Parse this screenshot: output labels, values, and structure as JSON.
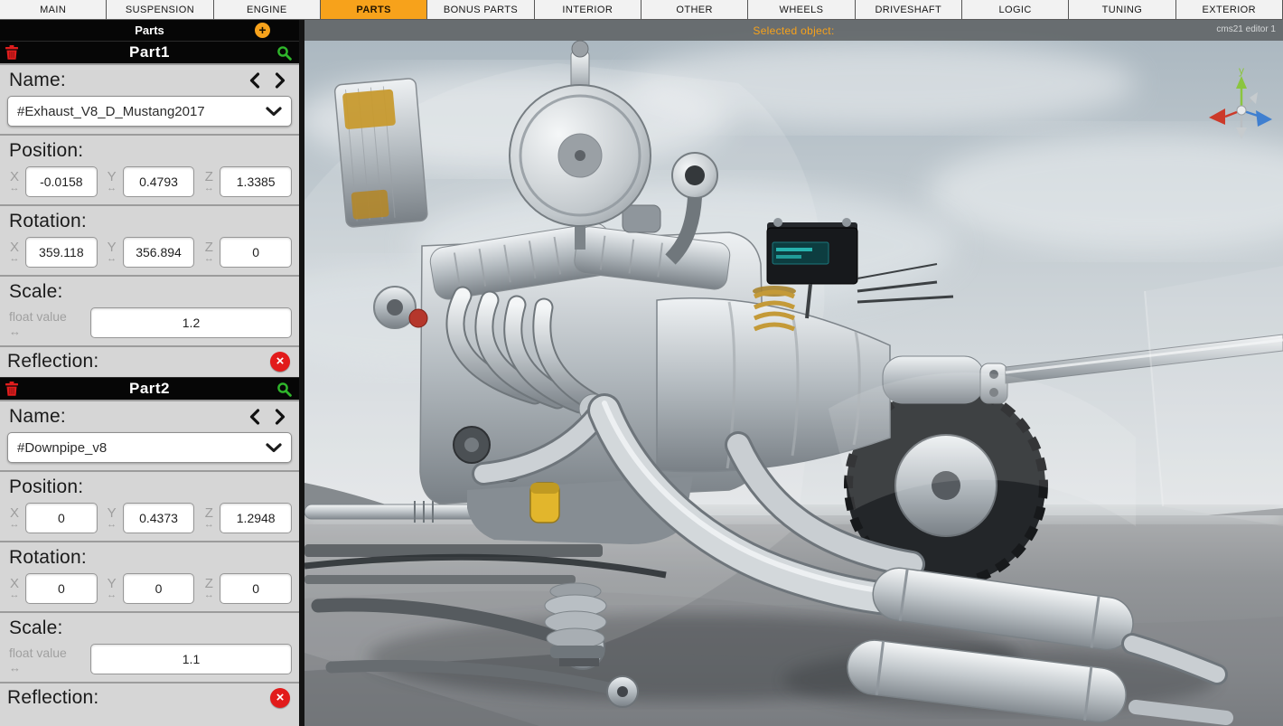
{
  "colors": {
    "accent_orange": "#F7A21B",
    "danger_red": "#E21B1B",
    "success_green": "#2FB62B"
  },
  "tabs": [
    {
      "label": "MAIN"
    },
    {
      "label": "SUSPENSION"
    },
    {
      "label": "ENGINE"
    },
    {
      "label": "PARTS"
    },
    {
      "label": "BONUS PARTS"
    },
    {
      "label": "INTERIOR"
    },
    {
      "label": "OTHER"
    },
    {
      "label": "WHEELS"
    },
    {
      "label": "DRIVESHAFT"
    },
    {
      "label": "LOGIC"
    },
    {
      "label": "TUNING"
    },
    {
      "label": "EXTERIOR"
    }
  ],
  "active_tab": "PARTS",
  "panel": {
    "title": "Parts",
    "labels": {
      "name": "Name:",
      "position": "Position:",
      "rotation": "Rotation:",
      "scale": "Scale:",
      "reflection": "Reflection:",
      "float_hint": "float value",
      "x": "X",
      "y": "Y",
      "z": "Z"
    },
    "icons": {
      "add": "+",
      "remove": "×",
      "axis_arrows": "↔"
    },
    "parts": [
      {
        "title": "Part1",
        "name_value": "#Exhaust_V8_D_Mustang2017",
        "position": {
          "x": "-0.0158",
          "y": "0.4793",
          "z": "1.3385"
        },
        "rotation": {
          "x": "359.118",
          "y": "356.894",
          "z": "0"
        },
        "scale": "1.2"
      },
      {
        "title": "Part2",
        "name_value": "#Downpipe_v8",
        "position": {
          "x": "0",
          "y": "0.4373",
          "z": "1.2948"
        },
        "rotation": {
          "x": "0",
          "y": "0",
          "z": "0"
        },
        "scale": "1.1"
      }
    ]
  },
  "viewport": {
    "selected_object_label": "Selected object:",
    "editor_watermark": "cms21 editor 1",
    "gizmo_y_label": "y"
  }
}
